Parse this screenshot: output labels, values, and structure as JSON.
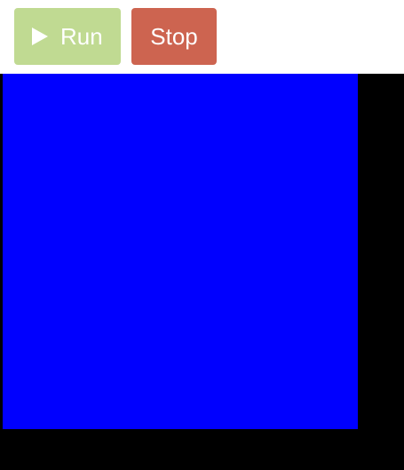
{
  "toolbar": {
    "run_label": "Run",
    "stop_label": "Stop",
    "run_icon": "play-icon"
  },
  "colors": {
    "run_button": "#c0da92",
    "stop_button": "#cd6450",
    "canvas_background": "#000000",
    "square": "#0000ff"
  }
}
